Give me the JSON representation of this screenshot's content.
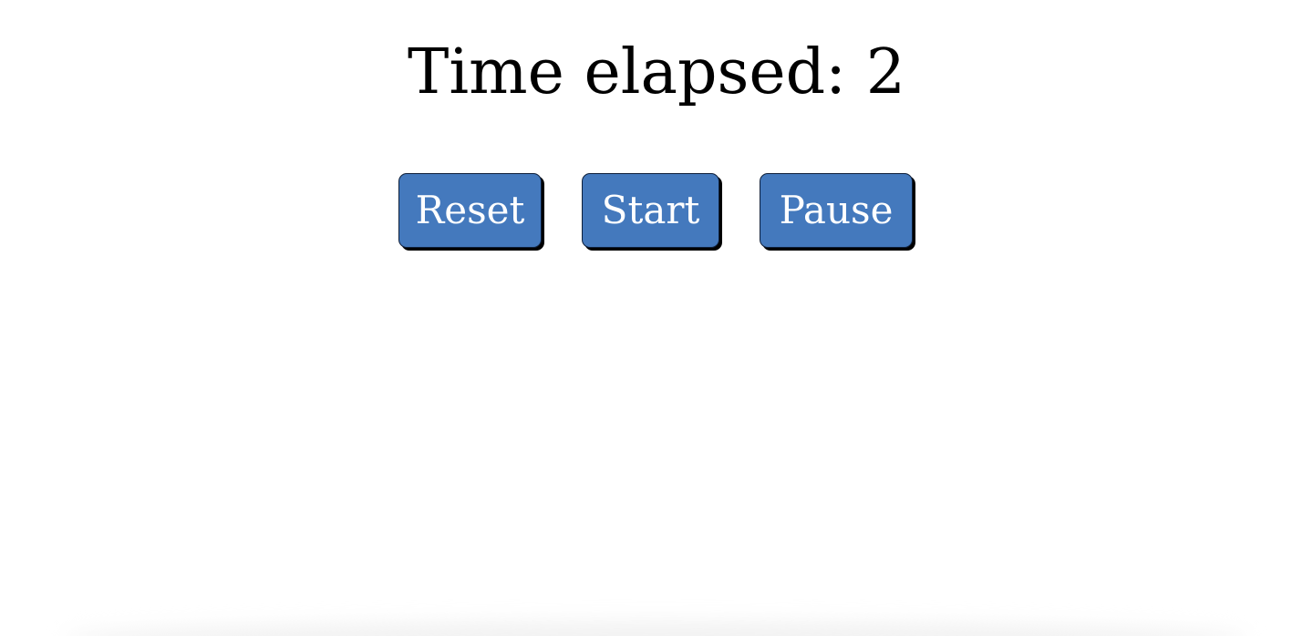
{
  "timer": {
    "label": "Time elapsed: 2"
  },
  "controls": {
    "reset_label": "Reset",
    "start_label": "Start",
    "pause_label": "Pause"
  },
  "colors": {
    "button_background": "#4479bd",
    "button_text": "#ffffff",
    "title_text": "#000000",
    "page_background": "#ffffff"
  }
}
